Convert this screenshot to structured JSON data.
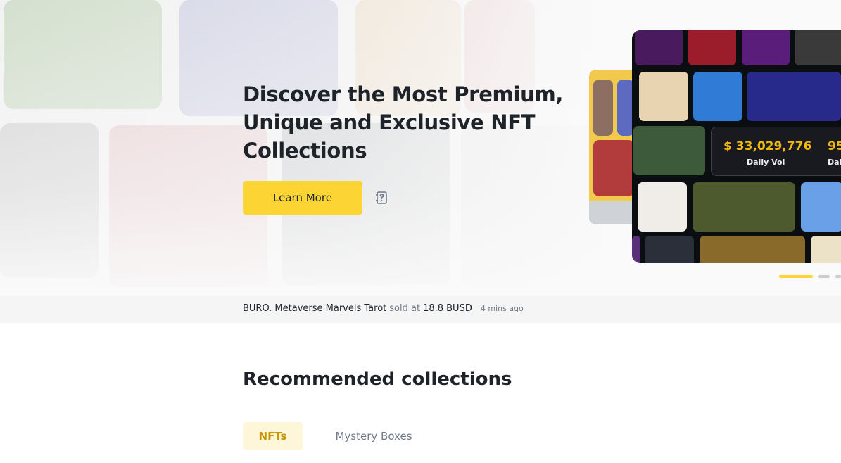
{
  "hero": {
    "headline": "Discover the Most Premium, Unique and Exclusive NFT Collections",
    "cta_label": "Learn More"
  },
  "stats": [
    {
      "value": "$ 33,029,776",
      "label": "Daily Vol"
    },
    {
      "value": "95",
      "label": "Dail"
    }
  ],
  "ticker": {
    "item": "BURO. Metaverse Marvels Tarot",
    "verb": "sold at",
    "price": "18.8 BUSD",
    "time": "4 mins ago"
  },
  "recommended": {
    "title": "Recommended collections",
    "tabs": [
      {
        "label": "NFTs",
        "active": true
      },
      {
        "label": "Mystery Boxes",
        "active": false
      }
    ]
  },
  "colors": {
    "brand_yellow": "#fcd535",
    "accent_gold": "#f0b90b",
    "text_primary": "#1e2329",
    "text_secondary": "#707a8a"
  },
  "icons": {
    "help": "help-book-icon"
  }
}
